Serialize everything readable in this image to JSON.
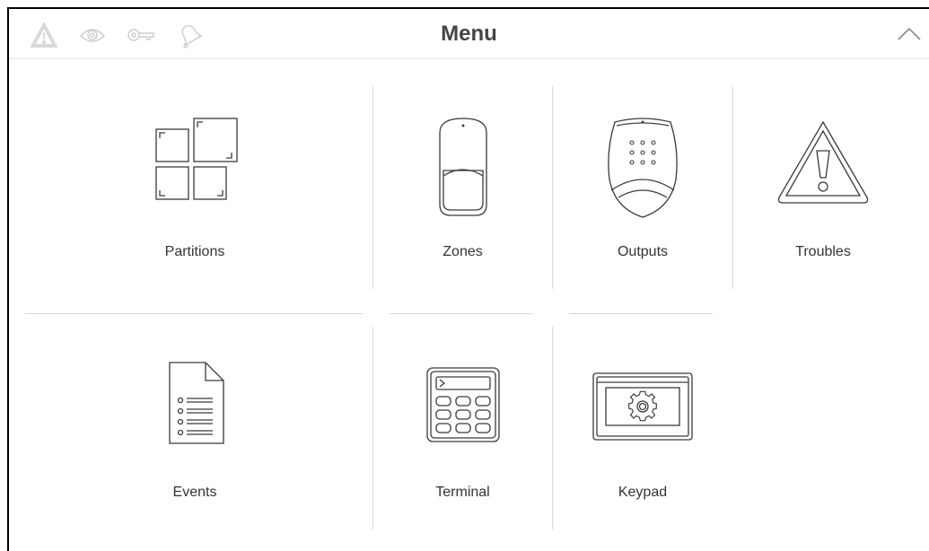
{
  "header": {
    "title": "Menu",
    "status_icons": [
      "alarm-warning-icon",
      "eye-icon",
      "key-icon",
      "bell-icon"
    ],
    "collapse_icon": "chevron-up-icon"
  },
  "menu": {
    "items": [
      {
        "label": "Partitions",
        "icon": "partitions-icon"
      },
      {
        "label": "Zones",
        "icon": "zones-icon"
      },
      {
        "label": "Outputs",
        "icon": "outputs-icon"
      },
      {
        "label": "Troubles",
        "icon": "troubles-icon"
      },
      {
        "label": "Events",
        "icon": "events-icon"
      },
      {
        "label": "Terminal",
        "icon": "terminal-icon"
      },
      {
        "label": "Keypad",
        "icon": "keypad-icon"
      }
    ]
  },
  "colors": {
    "line": "#3a3a3a",
    "header_icons": "#cccccc",
    "dividers": "#d9d9d9"
  }
}
